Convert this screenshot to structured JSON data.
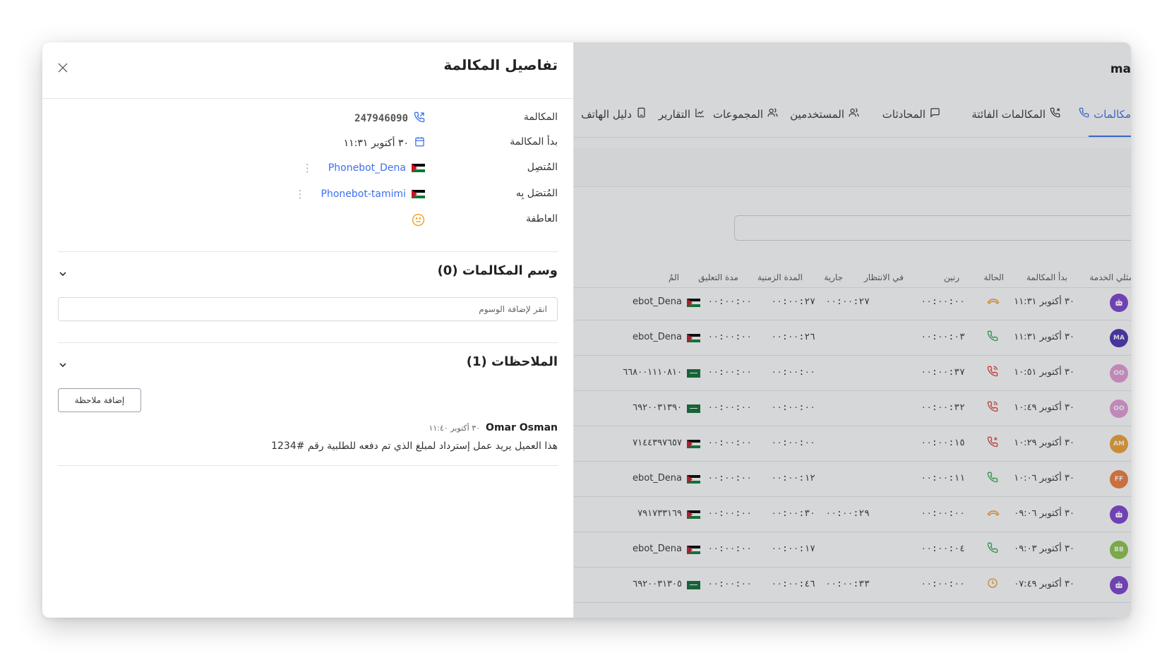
{
  "app": {
    "title": "ma"
  },
  "nav": {
    "tabs": [
      {
        "label": "مكالمات",
        "icon": "phone-icon",
        "active": true
      },
      {
        "label": "المكالمات الفائتة",
        "icon": "missed-call-icon"
      },
      {
        "label": "المحادثات",
        "icon": "chat-icon"
      },
      {
        "label": "المستخدمين",
        "icon": "users-icon"
      },
      {
        "label": "المجموعات",
        "icon": "group-icon"
      },
      {
        "label": "التقارير",
        "icon": "chart-icon"
      },
      {
        "label": "دليل الهاتف",
        "icon": "phonebook-icon"
      }
    ]
  },
  "table": {
    "headers": [
      "ممثلي الخدمة",
      "بدأ المكالمة",
      "الحالة",
      "رنين",
      "في الانتظار",
      "جارية",
      "المدة الزمنية",
      "مدة التعليق",
      "المُ"
    ],
    "rows": [
      {
        "avatar": "bot",
        "avatar_color": "#7b3fd0",
        "started": "٣٠ أكتوبر ١١:٣١",
        "status": "ongoing",
        "ring": "٠٠:٠٠:٠٠",
        "waiting": "",
        "active": "٠٠:٠٠:٢٧",
        "duration": "٠٠:٠٠:٢٧",
        "hold": "٠٠:٠٠:٠٠",
        "flag": "jo",
        "caller": "ebot_Dena"
      },
      {
        "avatar": "MA",
        "avatar_color": "#4a2fb3",
        "started": "٣٠ أكتوبر ١١:٣١",
        "status": "answered",
        "ring": "٠٠:٠٠:٠٣",
        "waiting": "",
        "active": "",
        "duration": "٠٠:٠٠:٢٦",
        "hold": "٠٠:٠٠:٠٠",
        "flag": "jo",
        "caller": "ebot_Dena"
      },
      {
        "avatar": "OO",
        "avatar_color": "#e39ad6",
        "started": "٣٠ أكتوبر ١٠:٥١",
        "status": "missed-in",
        "ring": "٠٠:٠٠:٣٧",
        "waiting": "",
        "active": "",
        "duration": "٠٠:٠٠:٠٠",
        "hold": "٠٠:٠٠:٠٠",
        "flag": "sa",
        "caller": "٦٦٨٠٠١١١٠٨١٠"
      },
      {
        "avatar": "OO",
        "avatar_color": "#e39ad6",
        "started": "٣٠ أكتوبر ١٠:٤٩",
        "status": "missed-in",
        "ring": "٠٠:٠٠:٣٢",
        "waiting": "",
        "active": "",
        "duration": "٠٠:٠٠:٠٠",
        "hold": "٠٠:٠٠:٠٠",
        "flag": "sa",
        "caller": "٦٩٢٠٠٣١٣٩٠"
      },
      {
        "avatar": "AM",
        "avatar_color": "#f0a030",
        "started": "٣٠ أكتوبر ١٠:٢٩",
        "status": "rejected",
        "ring": "٠٠:٠٠:١٥",
        "waiting": "",
        "active": "",
        "duration": "٠٠:٠٠:٠٠",
        "hold": "٠٠:٠٠:٠٠",
        "flag": "jo",
        "caller": "٧١٤٤٣٩٧٦٥٧"
      },
      {
        "avatar": "FF",
        "avatar_color": "#f07a3a",
        "started": "٣٠ أكتوبر ١٠:٠٦",
        "status": "answered",
        "ring": "٠٠:٠٠:١١",
        "waiting": "",
        "active": "",
        "duration": "٠٠:٠٠:١٢",
        "hold": "٠٠:٠٠:٠٠",
        "flag": "jo",
        "caller": "ebot_Dena"
      },
      {
        "avatar": "bot",
        "avatar_color": "#7b3fd0",
        "started": "٣٠ أكتوبر ٠٩:٠٦",
        "status": "ongoing",
        "ring": "٠٠:٠٠:٠٠",
        "waiting": "",
        "active": "٠٠:٠٠:٢٩",
        "duration": "٠٠:٠٠:٣٠",
        "hold": "٠٠:٠٠:٠٠",
        "flag": "jo",
        "caller": "٧٩١٧٣٣١٦٩"
      },
      {
        "avatar": "BB",
        "avatar_color": "#8bc34a",
        "started": "٣٠ أكتوبر ٠٩:٠٣",
        "status": "answered",
        "ring": "٠٠:٠٠:٠٤",
        "waiting": "",
        "active": "",
        "duration": "٠٠:٠٠:١٧",
        "hold": "٠٠:٠٠:٠٠",
        "flag": "jo",
        "caller": "ebot_Dena"
      },
      {
        "avatar": "bot",
        "avatar_color": "#7b3fd0",
        "started": "٣٠ أكتوبر ٠٧:٤٩",
        "status": "pending",
        "ring": "٠٠:٠٠:٠٠",
        "waiting": "",
        "active": "٠٠:٠٠:٣٣",
        "duration": "٠٠:٠٠:٤٦",
        "hold": "٠٠:٠٠:٠٠",
        "flag": "sa",
        "caller": "٦٩٢٠٠٣١٣٠٥"
      }
    ]
  },
  "drawer": {
    "title": "تفاصيل المكالمة",
    "details": {
      "call_label": "المكالمة",
      "call_value": "247946090",
      "started_label": "بدأ المكالمة",
      "started_value": "٣٠ أكتوبر ١١:٣١",
      "caller_label": "المُتصِل",
      "caller_value": "Phonebot_Dena",
      "callee_label": "المُتصَل بِه",
      "callee_value": "Phonebot-tamimi",
      "emotion_label": "العاطفة"
    },
    "tags": {
      "title": "وسم المكالمات (0)",
      "placeholder": "انقر لإضافة الوسوم"
    },
    "notes": {
      "title": "الملاحظات (1)",
      "add_button": "إضافة ملاحظة",
      "items": [
        {
          "author": "Omar Osman",
          "time": "٣٠ أكتوبر ١١:٤٠",
          "text": "هذا العميل يريد عمل إسترداد لمبلغ الذي تم دفعه للطلبية رقم #1234"
        }
      ]
    }
  },
  "colors": {
    "accent": "#3b6ff0",
    "answered": "#2ea44f",
    "missed": "#e03a3a",
    "ongoing": "#f09a30",
    "emotion": "#f0a020"
  }
}
